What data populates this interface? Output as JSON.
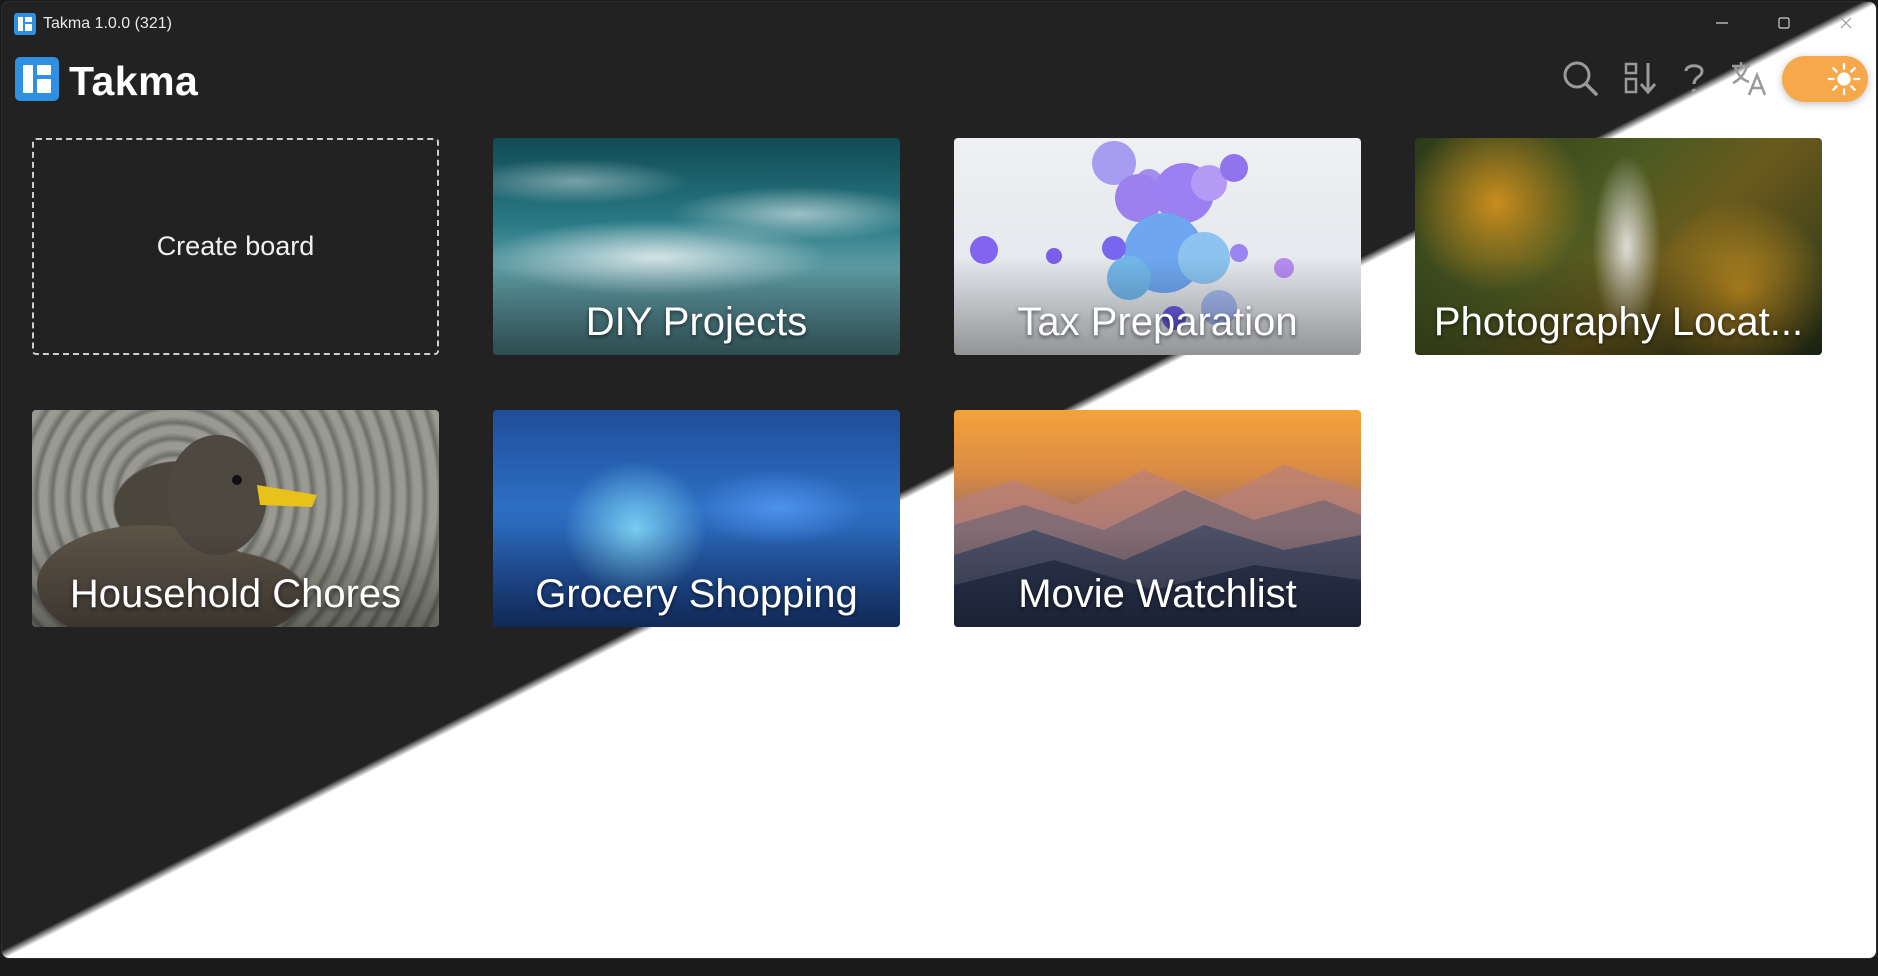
{
  "window": {
    "title": "Takma 1.0.0 (321)",
    "controls": [
      "minimize-icon",
      "maximize-icon",
      "close-icon"
    ]
  },
  "header": {
    "brand": "Takma",
    "tools": [
      "search-icon",
      "sort-icon",
      "help-icon",
      "translate-icon"
    ],
    "theme_toggle": {
      "state": "light",
      "icon": "sun-icon",
      "color": "#f7a84a"
    }
  },
  "create_board_label": "Create board",
  "boards": [
    {
      "title": "DIY Projects",
      "image": "ocean-waves"
    },
    {
      "title": "Tax Preparation",
      "image": "purple-bubbles"
    },
    {
      "title": "Photography Locat...",
      "image": "forest-road"
    },
    {
      "title": "Household Chores",
      "image": "duck-in-water"
    },
    {
      "title": "Grocery Shopping",
      "image": "blue-fantasy-scene"
    },
    {
      "title": "Movie Watchlist",
      "image": "mountain-sunset"
    }
  ],
  "colors": {
    "dark_background": "#222222",
    "light_background": "#ffffff",
    "brand_blue": "#2f8fe0"
  }
}
